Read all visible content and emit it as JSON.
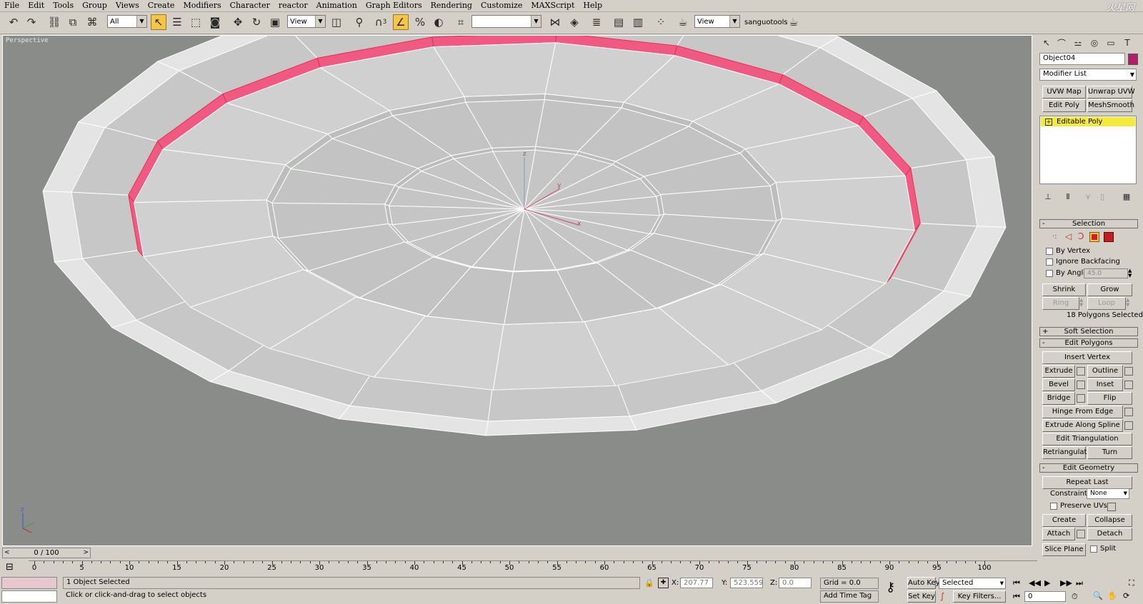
{
  "menu": [
    "File",
    "Edit",
    "Tools",
    "Group",
    "Views",
    "Create",
    "Modifiers",
    "Character",
    "reactor",
    "Animation",
    "Graph Editors",
    "Rendering",
    "Customize",
    "MAXScript",
    "Help"
  ],
  "watermark": "火星网",
  "toolbar": {
    "selection_filter": "All",
    "ref_coord": "View",
    "named_sel": "",
    "render_view": "View",
    "user_label": "sanguotools",
    "snap_number": "3"
  },
  "viewport": {
    "label": "Perspective",
    "axis_labels": {
      "z": "z",
      "y": "y",
      "x": "x"
    }
  },
  "panel": {
    "object_name": "Object04",
    "object_color": "#b0206a",
    "modifier_list": "Modifier List",
    "mod_buttons": [
      "UVW Map",
      "Unwrap UVW",
      "Edit Poly",
      "MeshSmooth"
    ],
    "stack_item": "Editable Poly",
    "selection": {
      "title": "Selection",
      "by_vertex": "By Vertex",
      "ignore_backfacing": "Ignore Backfacing",
      "by_angle": "By Angle:",
      "angle_value": "45.0",
      "shrink": "Shrink",
      "grow": "Grow",
      "ring": "Ring",
      "loop": "Loop",
      "status": "18 Polygons Selected"
    },
    "soft_selection": "Soft Selection",
    "edit_polygons": {
      "title": "Edit Polygons",
      "insert_vertex": "Insert Vertex",
      "extrude": "Extrude",
      "outline": "Outline",
      "bevel": "Bevel",
      "inset": "Inset",
      "bridge": "Bridge",
      "flip": "Flip",
      "hinge": "Hinge From Edge",
      "extrude_spline": "Extrude Along Spline",
      "edit_tri": "Edit Triangulation",
      "retriangulate": "Retriangulate",
      "turn": "Turn"
    },
    "edit_geometry": {
      "title": "Edit Geometry",
      "repeat_last": "Repeat Last",
      "constraints": "Constraints:",
      "constraints_value": "None",
      "preserve_uvs": "Preserve UVs",
      "create": "Create",
      "collapse": "Collapse",
      "attach": "Attach",
      "detach": "Detach",
      "slice_plane": "Slice Plane",
      "split": "Split"
    }
  },
  "timeline": {
    "slider": "0 / 100",
    "ticks": [
      "0",
      "5",
      "10",
      "15",
      "20",
      "25",
      "30",
      "35",
      "40",
      "45",
      "50",
      "55",
      "60",
      "65",
      "70",
      "75",
      "80",
      "85",
      "90",
      "95",
      "100"
    ]
  },
  "status": {
    "selected": "1 Object Selected",
    "prompt": "Click or click-and-drag to select objects",
    "x_label": "X:",
    "x_value": "207.77",
    "y_label": "Y:",
    "y_value": "523.559",
    "z_label": "Z:",
    "z_value": "0.0",
    "grid": "Grid = 0.0",
    "add_time_tag": "Add Time Tag",
    "auto_key": "Auto Key",
    "set_key": "Set Key",
    "key_mode": "Selected",
    "key_filters": "Key Filters...",
    "frame": "0"
  },
  "colors": {
    "selected_poly": "#f05a82",
    "unselected_poly": "#c8c9c8",
    "viewport_bg": "#8a8c8a",
    "active_tool": "#f3c64a"
  }
}
